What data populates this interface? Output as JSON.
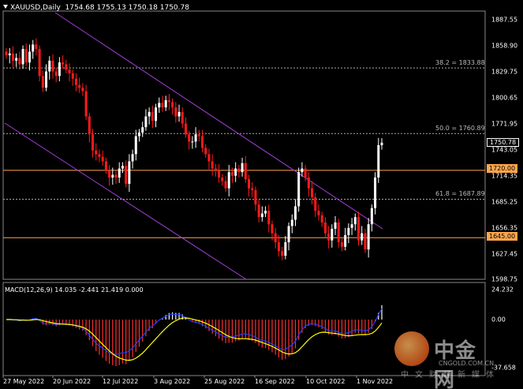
{
  "window": {
    "symbol": "XAUUSD,Daily",
    "ohlc": "1754.68 1755.13 1750.18 1750.78"
  },
  "price_axis": [
    "1887.55",
    "1858.90",
    "1829.75",
    "1800.65",
    "1771.95",
    "1743.05",
    "1714.35",
    "1685.25",
    "1656.35",
    "1627.45",
    "1598.75"
  ],
  "current_price": "1750.78",
  "levels": {
    "l1720": "1720.00",
    "l1645": "1645.00"
  },
  "fibo": {
    "f382": "38.2 = 1833.88",
    "f500": "50.0 = 1760.89",
    "f618": "61.8 = 1687.89"
  },
  "macd": {
    "title": "MACD(12,26,9) 14.035 -2.441 21.419 0.000",
    "axis_top": "24.232",
    "axis_mid": "0.00",
    "axis_bot": "-37.658"
  },
  "time_axis": [
    "27 May 2022",
    "20 Jun 2022",
    "12 Jul 2022",
    "3 Aug 2022",
    "25 Aug 2022",
    "16 Sep 2022",
    "10 Oct 2022",
    "1 Nov 2022"
  ],
  "watermark": {
    "brand": "中金网",
    "url": "CNGOLD.COM.CN",
    "slogan": "中文财经新媒体"
  },
  "colors": {
    "bull": "#ffffff",
    "bear": "#ff1a1a",
    "channel": "#a23fd6",
    "level_line": "#ffa64d",
    "signal_line": "#ffff00",
    "macd_line": "#1e40ff",
    "grid": "#555555"
  },
  "chart_data": {
    "type": "candlestick",
    "symbol": "XAUUSD",
    "timeframe": "Daily",
    "y_range": [
      1598.75,
      1887.55
    ],
    "closes": [
      1848,
      1850,
      1842,
      1845,
      1838,
      1855,
      1840,
      1852,
      1860,
      1855,
      1825,
      1812,
      1830,
      1842,
      1830,
      1825,
      1840,
      1838,
      1832,
      1828,
      1822,
      1815,
      1812,
      1808,
      1780,
      1760,
      1742,
      1738,
      1735,
      1730,
      1720,
      1712,
      1715,
      1712,
      1722,
      1725,
      1705,
      1730,
      1738,
      1758,
      1762,
      1768,
      1780,
      1785,
      1775,
      1790,
      1795,
      1790,
      1798,
      1796,
      1790,
      1780,
      1785,
      1772,
      1760,
      1752,
      1752,
      1760,
      1758,
      1745,
      1738,
      1730,
      1722,
      1720,
      1712,
      1708,
      1700,
      1718,
      1714,
      1722,
      1718,
      1728,
      1710,
      1700,
      1698,
      1682,
      1668,
      1672,
      1675,
      1660,
      1650,
      1640,
      1630,
      1625,
      1640,
      1658,
      1665,
      1680,
      1718,
      1722,
      1712,
      1700,
      1690,
      1675,
      1670,
      1662,
      1650,
      1642,
      1655,
      1662,
      1640,
      1635,
      1648,
      1656,
      1660,
      1668,
      1642,
      1650,
      1632,
      1660,
      1678,
      1712,
      1748,
      1750.78
    ],
    "support_resistance": [
      1720.0,
      1645.0
    ],
    "fibonacci": [
      {
        "level": 38.2,
        "price": 1833.88
      },
      {
        "level": 50.0,
        "price": 1760.89
      },
      {
        "level": 61.8,
        "price": 1687.89
      }
    ],
    "macd": {
      "fast": 12,
      "slow": 26,
      "signal": 9,
      "macd": 14.035,
      "signal_value": -2.441,
      "histogram": 21.419,
      "axis_range": [
        -37.658,
        24.232
      ]
    }
  }
}
